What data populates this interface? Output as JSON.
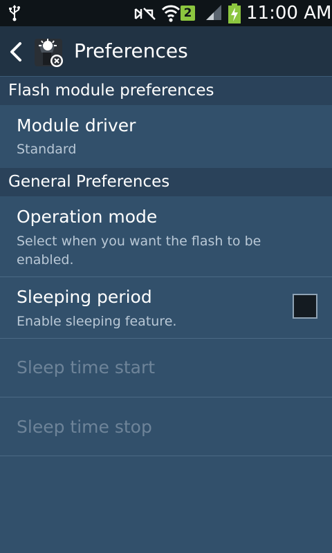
{
  "status_bar": {
    "clock": "11:00 AM",
    "sim_badge": "2",
    "colors": {
      "background": "#0e1418",
      "battery_fill": "#8cc63f"
    }
  },
  "action_bar": {
    "title": "Preferences",
    "back_icon": "chevron-left-icon",
    "app_icon": "flashlight-app-icon"
  },
  "sections": [
    {
      "header": "Flash module preferences",
      "items": [
        {
          "title": "Module driver",
          "summary": "Standard",
          "enabled": true
        }
      ]
    },
    {
      "header": "General Preferences",
      "items": [
        {
          "title": "Operation mode",
          "summary": "Select when you want the flash to be enabled.",
          "enabled": true
        },
        {
          "title": "Sleeping period",
          "summary": "Enable sleeping feature.",
          "enabled": true,
          "checkbox": {
            "checked": false
          }
        },
        {
          "title": "Sleep time start",
          "enabled": false
        },
        {
          "title": "Sleep time stop",
          "enabled": false
        }
      ]
    }
  ],
  "colors": {
    "background": "#32506b",
    "action_bar": "#213344",
    "section_header": "#2a425a",
    "summary_text": "#b9c8d6",
    "disabled_text": "#6e8499"
  }
}
